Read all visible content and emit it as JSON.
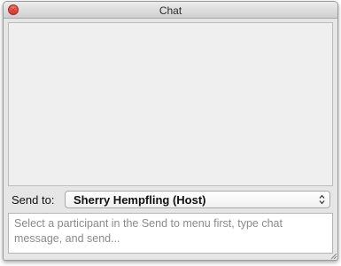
{
  "window": {
    "title": "Chat"
  },
  "send_to": {
    "label": "Send to:",
    "selected": "Sherry Hempfling (Host)"
  },
  "message": {
    "placeholder": "Select a participant in the Send to menu first, type chat message, and send..."
  },
  "icons": {
    "close": "close-icon",
    "select_arrows": "up-down-chevron-icon"
  },
  "colors": {
    "close_button": "#e0443a",
    "chat_background": "#efefef",
    "window_background": "#e6e6e6"
  }
}
